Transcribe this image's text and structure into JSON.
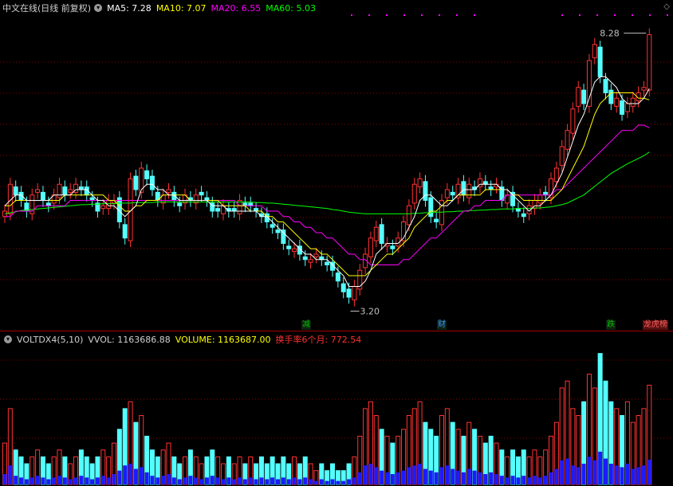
{
  "price_panel": {
    "title": "中文在线(日线 前复权)",
    "ma5": "MA5: 7.28",
    "ma10": "MA10: 7.07",
    "ma20": "MA20: 6.55",
    "ma60": "MA60: 5.03",
    "high_label": "8.28",
    "low_label": "3.20",
    "menu_icon": "chevron-down-icon",
    "corner_icon": "diamond-icon"
  },
  "event_tags": [
    {
      "text": "减",
      "color": "#00c000"
    },
    {
      "text": "财",
      "color": "#3399ff"
    },
    {
      "text": "跌",
      "color": "#00c000"
    },
    {
      "text": "龙虎榜",
      "color": "#ff6060"
    }
  ],
  "volume_panel": {
    "indicator": "VOLTDX4(5,10)",
    "vvol": "VVOL: 1163686.88",
    "volume": "VOLUME: 1163687.00",
    "turnover": "换手率6个月: 772.54"
  },
  "colors": {
    "up": "#ff3232",
    "down": "#54ffff",
    "ma5": "#ffffff",
    "ma10": "#ffff00",
    "ma20": "#ff00ff",
    "ma60": "#00ff00",
    "grid": "#8b0000",
    "vol_blue": "#1b1bff"
  },
  "chart_data": {
    "type": "candlestick",
    "low": 3.2,
    "high": 8.28,
    "closes": [
      5.0,
      5.5,
      5.3,
      5.2,
      5.0,
      5.3,
      5.4,
      5.2,
      5.1,
      5.3,
      5.5,
      5.3,
      5.4,
      5.5,
      5.4,
      5.3,
      5.2,
      5.0,
      5.1,
      5.2,
      5.2,
      4.8,
      4.5,
      5.6,
      5.4,
      5.8,
      5.6,
      5.4,
      5.2,
      5.3,
      5.4,
      5.2,
      5.1,
      5.3,
      5.2,
      5.3,
      5.3,
      5.2,
      5.0,
      5.0,
      5.1,
      5.0,
      5.0,
      5.2,
      5.1,
      5.1,
      5.0,
      4.9,
      4.8,
      4.7,
      4.6,
      4.4,
      4.3,
      4.3,
      4.2,
      4.1,
      4.1,
      4.2,
      4.1,
      4.0,
      3.9,
      3.7,
      3.5,
      3.4,
      3.6,
      3.9,
      4.2,
      4.5,
      4.7,
      4.4,
      4.4,
      4.3,
      4.5,
      4.8,
      5.1,
      5.5,
      5.6,
      5.2,
      4.9,
      4.8,
      5.2,
      5.4,
      5.3,
      5.5,
      5.3,
      5.5,
      5.4,
      5.6,
      5.5,
      5.4,
      5.5,
      5.2,
      5.3,
      5.1,
      5.0,
      4.9,
      5.1,
      5.2,
      5.3,
      5.3,
      5.6,
      5.8,
      6.2,
      6.5,
      6.9,
      7.3,
      7.0,
      7.8,
      8.1,
      7.5,
      7.2,
      7.0,
      7.1,
      6.8,
      7.0,
      7.1,
      7.2,
      7.3,
      8.28
    ],
    "ma5": [
      5.1,
      5.2,
      5.3,
      5.3,
      5.2,
      5.2,
      5.2,
      5.2,
      5.2,
      5.3,
      5.3,
      5.3,
      5.3,
      5.4,
      5.4,
      5.4,
      5.3,
      5.2,
      5.2,
      5.1,
      5.1,
      5.0,
      4.9,
      5.0,
      5.1,
      5.4,
      5.5,
      5.5,
      5.4,
      5.4,
      5.3,
      5.3,
      5.2,
      5.2,
      5.2,
      5.2,
      5.2,
      5.2,
      5.1,
      5.1,
      5.1,
      5.0,
      5.0,
      5.0,
      5.0,
      5.0,
      5.0,
      4.9,
      4.9,
      4.8,
      4.7,
      4.6,
      4.5,
      4.4,
      4.3,
      4.2,
      4.2,
      4.1,
      4.1,
      4.1,
      4.0,
      3.9,
      3.8,
      3.6,
      3.6,
      3.6,
      3.7,
      3.9,
      4.2,
      4.3,
      4.4,
      4.4,
      4.4,
      4.5,
      4.7,
      4.9,
      5.2,
      5.3,
      5.3,
      5.2,
      5.1,
      5.1,
      5.2,
      5.3,
      5.4,
      5.4,
      5.4,
      5.5,
      5.5,
      5.5,
      5.5,
      5.4,
      5.4,
      5.3,
      5.2,
      5.1,
      5.0,
      5.1,
      5.1,
      5.2,
      5.3,
      5.5,
      5.7,
      6.0,
      6.3,
      6.6,
      6.8,
      7.1,
      7.4,
      7.5,
      7.5,
      7.4,
      7.3,
      7.1,
      7.0,
      7.0,
      7.0,
      7.1,
      7.28
    ],
    "ma10": [
      5.1,
      5.1,
      5.2,
      5.2,
      5.2,
      5.2,
      5.2,
      5.2,
      5.2,
      5.2,
      5.2,
      5.3,
      5.3,
      5.3,
      5.3,
      5.3,
      5.3,
      5.3,
      5.3,
      5.2,
      5.2,
      5.1,
      5.0,
      5.0,
      5.1,
      5.1,
      5.2,
      5.2,
      5.2,
      5.3,
      5.3,
      5.3,
      5.3,
      5.3,
      5.2,
      5.2,
      5.2,
      5.2,
      5.2,
      5.2,
      5.1,
      5.1,
      5.1,
      5.1,
      5.1,
      5.0,
      5.0,
      5.0,
      4.9,
      4.9,
      4.8,
      4.8,
      4.7,
      4.6,
      4.5,
      4.4,
      4.3,
      4.3,
      4.2,
      4.2,
      4.1,
      4.0,
      3.9,
      3.8,
      3.8,
      3.8,
      3.8,
      3.9,
      4.0,
      4.1,
      4.2,
      4.2,
      4.3,
      4.4,
      4.5,
      4.7,
      4.8,
      4.9,
      5.0,
      5.0,
      5.1,
      5.2,
      5.2,
      5.3,
      5.3,
      5.3,
      5.3,
      5.3,
      5.4,
      5.4,
      5.4,
      5.4,
      5.4,
      5.3,
      5.3,
      5.2,
      5.2,
      5.2,
      5.2,
      5.2,
      5.2,
      5.3,
      5.4,
      5.6,
      5.8,
      6.0,
      6.2,
      6.5,
      6.8,
      7.0,
      7.1,
      7.2,
      7.2,
      7.2,
      7.2,
      7.2,
      7.1,
      7.1,
      7.07
    ],
    "ma20": [
      4.9,
      4.9,
      5.0,
      5.0,
      5.0,
      5.0,
      5.1,
      5.1,
      5.1,
      5.1,
      5.1,
      5.1,
      5.2,
      5.2,
      5.2,
      5.2,
      5.2,
      5.2,
      5.2,
      5.2,
      5.2,
      5.2,
      5.2,
      5.2,
      5.2,
      5.2,
      5.2,
      5.2,
      5.2,
      5.2,
      5.2,
      5.2,
      5.2,
      5.2,
      5.2,
      5.2,
      5.2,
      5.2,
      5.2,
      5.2,
      5.2,
      5.2,
      5.2,
      5.1,
      5.1,
      5.1,
      5.1,
      5.1,
      5.0,
      5.0,
      5.0,
      4.9,
      4.9,
      4.8,
      4.8,
      4.7,
      4.7,
      4.6,
      4.6,
      4.5,
      4.5,
      4.4,
      4.3,
      4.2,
      4.2,
      4.1,
      4.1,
      4.0,
      4.0,
      4.0,
      4.0,
      4.0,
      4.0,
      4.1,
      4.1,
      4.2,
      4.3,
      4.4,
      4.5,
      4.5,
      4.6,
      4.7,
      4.8,
      4.9,
      5.0,
      5.0,
      5.1,
      5.1,
      5.2,
      5.2,
      5.2,
      5.2,
      5.3,
      5.3,
      5.3,
      5.3,
      5.3,
      5.3,
      5.3,
      5.3,
      5.3,
      5.4,
      5.4,
      5.5,
      5.6,
      5.7,
      5.8,
      5.9,
      6.0,
      6.1,
      6.2,
      6.3,
      6.4,
      6.5,
      6.5,
      6.5,
      6.6,
      6.6,
      6.55
    ],
    "ma60": [
      4.95,
      4.97,
      4.99,
      5.01,
      5.02,
      5.03,
      5.04,
      5.05,
      5.06,
      5.07,
      5.08,
      5.09,
      5.1,
      5.11,
      5.12,
      5.12,
      5.13,
      5.13,
      5.14,
      5.14,
      5.14,
      5.15,
      5.15,
      5.15,
      5.16,
      5.16,
      5.16,
      5.16,
      5.17,
      5.17,
      5.17,
      5.17,
      5.17,
      5.17,
      5.17,
      5.17,
      5.17,
      5.17,
      5.17,
      5.17,
      5.17,
      5.17,
      5.17,
      5.17,
      5.17,
      5.17,
      5.16,
      5.16,
      5.15,
      5.15,
      5.14,
      5.13,
      5.12,
      5.11,
      5.1,
      5.09,
      5.08,
      5.07,
      5.06,
      5.05,
      5.03,
      5.02,
      5.0,
      4.98,
      4.97,
      4.96,
      4.95,
      4.95,
      4.95,
      4.95,
      4.95,
      4.95,
      4.95,
      4.95,
      4.95,
      4.96,
      4.96,
      4.97,
      4.97,
      4.98,
      4.98,
      4.99,
      4.99,
      5.0,
      5.0,
      5.01,
      5.01,
      5.02,
      5.02,
      5.03,
      5.03,
      5.04,
      5.04,
      5.04,
      5.05,
      5.05,
      5.05,
      5.06,
      5.06,
      5.07,
      5.08,
      5.1,
      5.12,
      5.15,
      5.2,
      5.25,
      5.3,
      5.38,
      5.46,
      5.54,
      5.62,
      5.7,
      5.76,
      5.82,
      5.88,
      5.93,
      5.98,
      6.03,
      6.1
    ],
    "volumes": [
      0.3,
      0.55,
      0.25,
      0.2,
      0.15,
      0.2,
      0.25,
      0.2,
      0.15,
      0.2,
      0.25,
      0.2,
      0.15,
      0.2,
      0.25,
      0.2,
      0.15,
      0.2,
      0.25,
      0.2,
      0.3,
      0.4,
      0.55,
      0.6,
      0.45,
      0.5,
      0.35,
      0.25,
      0.2,
      0.25,
      0.3,
      0.2,
      0.15,
      0.2,
      0.25,
      0.2,
      0.15,
      0.2,
      0.25,
      0.2,
      0.15,
      0.2,
      0.15,
      0.2,
      0.15,
      0.2,
      0.15,
      0.2,
      0.15,
      0.2,
      0.15,
      0.2,
      0.15,
      0.2,
      0.15,
      0.2,
      0.15,
      0.1,
      0.15,
      0.1,
      0.15,
      0.1,
      0.1,
      0.15,
      0.2,
      0.35,
      0.55,
      0.6,
      0.5,
      0.4,
      0.35,
      0.3,
      0.35,
      0.4,
      0.5,
      0.55,
      0.6,
      0.45,
      0.4,
      0.35,
      0.5,
      0.55,
      0.45,
      0.4,
      0.35,
      0.45,
      0.4,
      0.35,
      0.3,
      0.35,
      0.3,
      0.25,
      0.2,
      0.25,
      0.2,
      0.25,
      0.2,
      0.25,
      0.2,
      0.25,
      0.35,
      0.45,
      0.7,
      0.75,
      0.55,
      0.5,
      0.6,
      0.8,
      0.7,
      0.95,
      0.75,
      0.6,
      0.55,
      0.5,
      0.6,
      0.45,
      0.5,
      0.55,
      0.72
    ]
  }
}
